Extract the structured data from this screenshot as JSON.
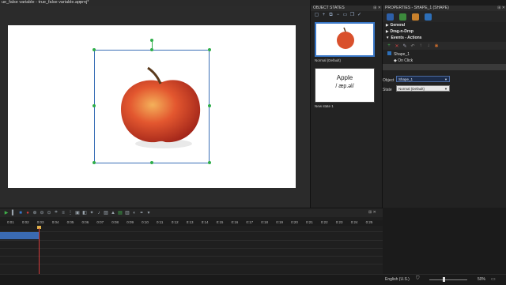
{
  "document": {
    "tab_title": "ue_false variable - true_false variable.apprnj*",
    "close_label": "×"
  },
  "states_panel": {
    "title": "OBJECT STATES",
    "states": [
      {
        "label": "Normal (Default)"
      },
      {
        "label": "New state 1",
        "word": "Apple",
        "phonetic": "/ æp.əl/"
      }
    ]
  },
  "properties_panel": {
    "title": "PROPERTIES - SHAPE_1 (SHAPE)",
    "sections": [
      "General",
      "Drag-n-Drop",
      "Events - Actions"
    ],
    "tree": {
      "object": "Shape_1",
      "event": "On Click"
    },
    "fields": {
      "object_label": "Object",
      "object_value": "Shape_1",
      "state_label": "State",
      "state_value": "Normal (Default)"
    }
  },
  "timeline": {
    "ticks": [
      "0:01",
      "0:02",
      "0:03",
      "0:04",
      "0:05",
      "0:06",
      "0:07",
      "0:08",
      "0:09",
      "0:10",
      "0:11",
      "0:12",
      "0:13",
      "0:14",
      "0:15",
      "0:16",
      "0:17",
      "0:18",
      "0:19",
      "0:20",
      "0:21",
      "0:22",
      "0:23",
      "0:24",
      "0:25"
    ]
  },
  "status": {
    "language": "English (U.S.)",
    "zoom": "50%"
  },
  "colors": {
    "accent": "#3a78c8",
    "handle": "#2fae49",
    "playhead": "#d43b3b"
  }
}
